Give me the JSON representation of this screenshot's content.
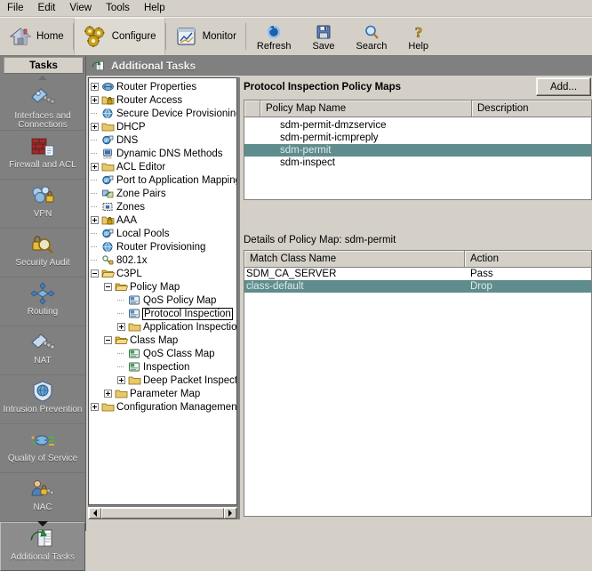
{
  "menubar": {
    "items": [
      {
        "label": "File"
      },
      {
        "label": "Edit"
      },
      {
        "label": "View"
      },
      {
        "label": "Tools"
      },
      {
        "label": "Help"
      }
    ]
  },
  "toolbar": {
    "home_label": "Home",
    "configure_label": "Configure",
    "monitor_label": "Monitor",
    "refresh_label": "Refresh",
    "save_label": "Save",
    "search_label": "Search",
    "help_label": "Help",
    "home_icon": "home-icon",
    "configure_icon": "gears-icon",
    "monitor_icon": "monitor-chart-icon",
    "refresh_icon": "refresh-icon",
    "save_icon": "floppy-disk-icon",
    "search_icon": "magnifier-icon",
    "help_icon": "question-mark-icon"
  },
  "sidebar": {
    "header": "Tasks",
    "items": [
      {
        "label": "Interfaces and Connections",
        "icon": "interfaces-icon",
        "active": false
      },
      {
        "label": "Firewall and ACL",
        "icon": "firewall-brick-icon",
        "active": false
      },
      {
        "label": "VPN",
        "icon": "vpn-lock-cloud-icon",
        "active": false
      },
      {
        "label": "Security Audit",
        "icon": "security-audit-magnifier-icon",
        "active": false
      },
      {
        "label": "Routing",
        "icon": "routing-diamond-icon",
        "active": false
      },
      {
        "label": "NAT",
        "icon": "nat-icon",
        "active": false
      },
      {
        "label": "Intrusion Prevention",
        "icon": "shield-icon",
        "active": false
      },
      {
        "label": "Quality of Service",
        "icon": "qos-router-icon",
        "active": false
      },
      {
        "label": "NAC",
        "icon": "nac-user-lock-icon",
        "active": false
      },
      {
        "label": "Additional Tasks",
        "icon": "additional-tasks-icon",
        "active": true
      }
    ],
    "scroll_up_icon": "scroll-up-arrow-icon",
    "scroll_down_icon": "scroll-down-arrow-icon"
  },
  "content_header": {
    "title": "Additional Tasks",
    "icon": "additional-tasks-icon"
  },
  "tree": {
    "nodes": [
      {
        "label": "Router Properties",
        "depth": 0,
        "toggle": "plus",
        "icon": "router-icon",
        "selected": false
      },
      {
        "label": "Router Access",
        "depth": 0,
        "toggle": "plus",
        "icon": "folder-lock-icon",
        "selected": false
      },
      {
        "label": "Secure Device Provisioning",
        "depth": 0,
        "toggle": "none",
        "icon": "globe-icon",
        "selected": false
      },
      {
        "label": "DHCP",
        "depth": 0,
        "toggle": "plus",
        "icon": "folder-icon",
        "selected": false
      },
      {
        "label": "DNS",
        "depth": 0,
        "toggle": "none",
        "icon": "ip-icon",
        "selected": false
      },
      {
        "label": "Dynamic DNS Methods",
        "depth": 0,
        "toggle": "none",
        "icon": "dns-icon",
        "selected": false
      },
      {
        "label": "ACL Editor",
        "depth": 0,
        "toggle": "plus",
        "icon": "folder-icon",
        "selected": false
      },
      {
        "label": "Port to Application Mappings",
        "depth": 0,
        "toggle": "none",
        "icon": "ip-icon",
        "selected": false
      },
      {
        "label": "Zone Pairs",
        "depth": 0,
        "toggle": "none",
        "icon": "zonepair-icon",
        "selected": false
      },
      {
        "label": "Zones",
        "depth": 0,
        "toggle": "none",
        "icon": "zone-icon",
        "selected": false
      },
      {
        "label": "AAA",
        "depth": 0,
        "toggle": "plus",
        "icon": "folder-lock-icon",
        "selected": false
      },
      {
        "label": "Local Pools",
        "depth": 0,
        "toggle": "none",
        "icon": "ip-icon",
        "selected": false
      },
      {
        "label": "Router Provisioning",
        "depth": 0,
        "toggle": "none",
        "icon": "globe-icon",
        "selected": false
      },
      {
        "label": "802.1x",
        "depth": 0,
        "toggle": "none",
        "icon": "dot1x-icon",
        "selected": false
      },
      {
        "label": "C3PL",
        "depth": 0,
        "toggle": "minus",
        "icon": "folder-open-icon",
        "selected": false
      },
      {
        "label": "Policy Map",
        "depth": 1,
        "toggle": "minus",
        "icon": "folder-open-icon",
        "selected": false
      },
      {
        "label": "QoS Policy Map",
        "depth": 2,
        "toggle": "none",
        "icon": "policymap-icon",
        "selected": false
      },
      {
        "label": "Protocol Inspection",
        "depth": 2,
        "toggle": "none",
        "icon": "policymap-icon",
        "selected": true
      },
      {
        "label": "Application Inspection",
        "depth": 2,
        "toggle": "plus",
        "icon": "folder-icon",
        "selected": false
      },
      {
        "label": "Class Map",
        "depth": 1,
        "toggle": "minus",
        "icon": "folder-open-icon",
        "selected": false
      },
      {
        "label": "QoS Class Map",
        "depth": 2,
        "toggle": "none",
        "icon": "classmap-icon",
        "selected": false
      },
      {
        "label": "Inspection",
        "depth": 2,
        "toggle": "none",
        "icon": "classmap-icon",
        "selected": false
      },
      {
        "label": "Deep Packet Inspection",
        "depth": 2,
        "toggle": "plus",
        "icon": "folder-icon",
        "selected": false
      },
      {
        "label": "Parameter Map",
        "depth": 1,
        "toggle": "plus",
        "icon": "folder-icon",
        "selected": false
      },
      {
        "label": "Configuration Management",
        "depth": 0,
        "toggle": "plus",
        "icon": "folder-icon",
        "selected": false
      }
    ],
    "hscroll_left_icon": "scroll-left-arrow-icon",
    "hscroll_right_icon": "scroll-right-arrow-icon"
  },
  "main": {
    "panel_title": "Protocol Inspection Policy Maps",
    "add_button": "Add...",
    "add_button_2": "",
    "policy_table": {
      "columns": [
        "",
        "Policy Map Name",
        "Description"
      ],
      "rows": [
        {
          "name": "sdm-permit-dmzservice",
          "description": "",
          "selected": false
        },
        {
          "name": "sdm-permit-icmpreply",
          "description": "",
          "selected": false
        },
        {
          "name": "sdm-permit",
          "description": "",
          "selected": true
        },
        {
          "name": "sdm-inspect",
          "description": "",
          "selected": false
        }
      ]
    },
    "details_title": "Details of Policy Map: sdm-permit",
    "details_table": {
      "columns": [
        "Match Class Name",
        "Action"
      ],
      "rows": [
        {
          "match_class": "SDM_CA_SERVER",
          "action": "Pass",
          "selected": false
        },
        {
          "match_class": "class-default",
          "action": "Drop",
          "selected": true
        }
      ]
    }
  },
  "colors": {
    "window_bg": "#d4d0c8",
    "panel_gray": "#808080",
    "selection_teal": "#5f8c8c",
    "header_text": "#f2f2f2"
  }
}
